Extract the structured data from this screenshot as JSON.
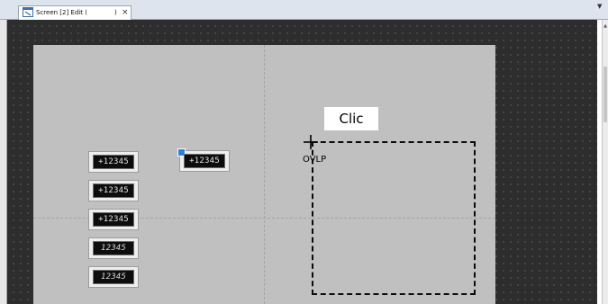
{
  "tab": {
    "label": "Screen [2] Edit (",
    "label_suffix": ")",
    "close_glyph": "×",
    "icon": "screen-edit-icon"
  },
  "menu_arrow_glyph": "▼",
  "scrollbar": {
    "up_glyph": "▲"
  },
  "canvas_parts": [
    {
      "value": "+12345",
      "style": "plain"
    },
    {
      "value": "+12345",
      "style": "plain"
    },
    {
      "value": "+12345",
      "style": "plain"
    },
    {
      "value": "12345",
      "style": "segment"
    },
    {
      "value": "12345",
      "style": "segment"
    }
  ],
  "selected_part": {
    "value": "+12345"
  },
  "tooltip": {
    "text": "Clic"
  },
  "cursor_label": "OVLP",
  "colors": {
    "editor_bg": "#2d2d2d",
    "canvas_bg": "#c0c0c0",
    "tab_strip": "#dde4ee",
    "selection": "#2f7fd6"
  }
}
